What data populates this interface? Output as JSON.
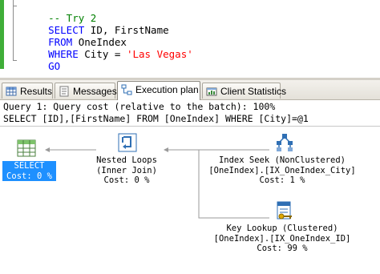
{
  "editor": {
    "lines": {
      "comment": "-- Try 2",
      "select_kw": "SELECT",
      "select_rest": " ID, FirstName",
      "from_kw": "FROM",
      "from_rest": " OneIndex",
      "where_kw": "WHERE",
      "where_rest": " City = ",
      "where_str": "'Las Vegas'",
      "go_kw": "GO"
    }
  },
  "tabs": [
    {
      "label": "Results",
      "icon": "grid-icon",
      "active": false
    },
    {
      "label": "Messages",
      "icon": "messages-icon",
      "active": false
    },
    {
      "label": "Execution plan",
      "icon": "execution-plan-icon",
      "active": true
    },
    {
      "label": "Client Statistics",
      "icon": "client-statistics-icon",
      "active": false
    }
  ],
  "plan": {
    "query_line": "Query 1: Query cost (relative to the batch): 100%",
    "sql_line": "SELECT [ID],[FirstName] FROM [OneIndex] WHERE [City]=@1",
    "operators": {
      "select": {
        "name": "SELECT",
        "cost": "Cost: 0 %",
        "icon": "select-result-icon"
      },
      "nested_loops": {
        "name": "Nested Loops",
        "detail": "(Inner Join)",
        "cost": "Cost: 0 %",
        "icon": "nested-loops-icon"
      },
      "index_seek": {
        "name": "Index Seek (NonClustered)",
        "detail": "[OneIndex].[IX_OneIndex_City]",
        "cost": "Cost: 1 %",
        "icon": "index-seek-icon"
      },
      "key_lookup": {
        "name": "Key Lookup (Clustered)",
        "detail": "[OneIndex].[IX_OneIndex_ID]",
        "cost": "Cost: 99 %",
        "icon": "key-lookup-icon"
      }
    }
  },
  "colors": {
    "keyword": "#0000ff",
    "comment": "#008000",
    "string": "#ff0000",
    "selection": "#1e90ff",
    "change_bar": "#3fae38"
  }
}
